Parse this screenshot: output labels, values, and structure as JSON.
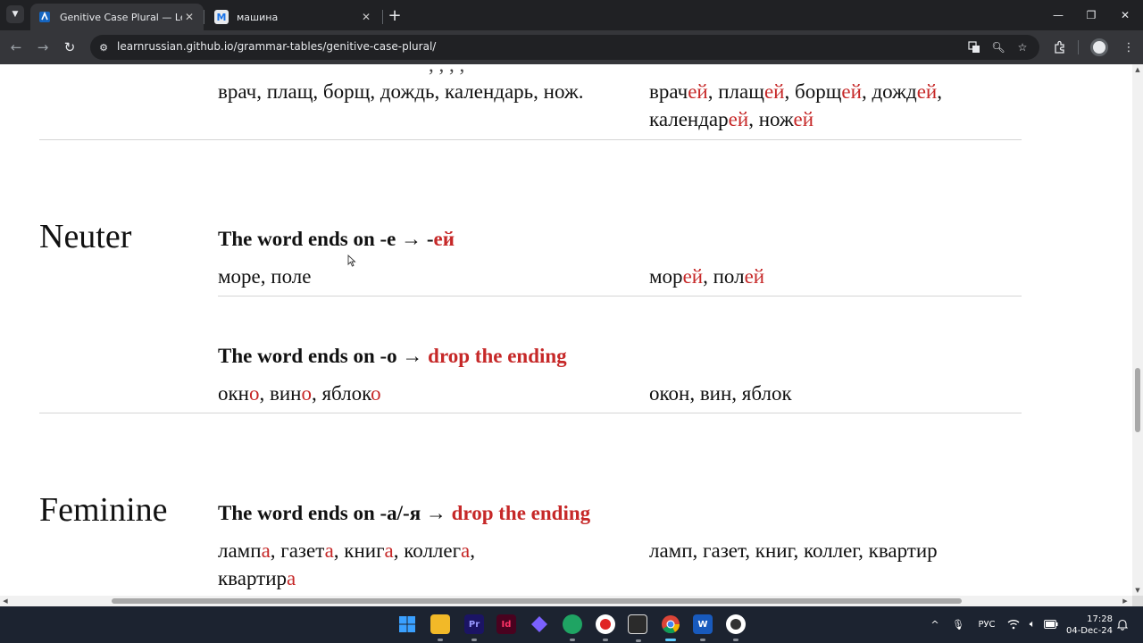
{
  "browser": {
    "tabs": [
      {
        "title": "Genitive Case Plural — LearnRu",
        "favicon": "learnrussian-favicon",
        "active": true
      },
      {
        "title": "машина",
        "favicon": "M",
        "active": false
      }
    ],
    "url": "learnrussian.github.io/grammar-tables/genitive-case-plural/"
  },
  "page": {
    "masculine_tail": {
      "cut_text": ", , , ,",
      "left_parts": [
        {
          "t": "врач, плащ, борщ, дождь, календарь, нож.",
          "r": false
        }
      ],
      "right_parts": [
        {
          "t": "врач",
          "r": false
        },
        {
          "t": "ей",
          "r": true
        },
        {
          "t": ", плащ",
          "r": false
        },
        {
          "t": "ей",
          "r": true
        },
        {
          "t": ", борщ",
          "r": false
        },
        {
          "t": "ей",
          "r": true
        },
        {
          "t": ", дожд",
          "r": false
        },
        {
          "t": "ей",
          "r": true
        },
        {
          "t": ", календар",
          "r": false
        },
        {
          "t": "ей",
          "r": true
        },
        {
          "t": ", нож",
          "r": false
        },
        {
          "t": "ей",
          "r": true
        }
      ]
    },
    "neuter": {
      "label": "Neuter",
      "rules": [
        {
          "rule_parts": [
            {
              "t": "The word ends on -е → -",
              "r": false
            },
            {
              "t": "ей",
              "r": true
            }
          ],
          "left_parts": [
            {
              "t": "море, поле",
              "r": false
            }
          ],
          "right_parts": [
            {
              "t": "мор",
              "r": false
            },
            {
              "t": "ей",
              "r": true
            },
            {
              "t": ", пол",
              "r": false
            },
            {
              "t": "ей",
              "r": true
            }
          ]
        },
        {
          "rule_parts": [
            {
              "t": "The word ends on -о → ",
              "r": false
            },
            {
              "t": "drop the ending",
              "r": true
            }
          ],
          "left_parts": [
            {
              "t": "окн",
              "r": false
            },
            {
              "t": "о",
              "r": true
            },
            {
              "t": ", вин",
              "r": false
            },
            {
              "t": "о",
              "r": true
            },
            {
              "t": ", яблок",
              "r": false
            },
            {
              "t": "о",
              "r": true
            }
          ],
          "right_parts": [
            {
              "t": "окон, вин, яблок",
              "r": false
            }
          ]
        }
      ]
    },
    "feminine": {
      "label": "Feminine",
      "rules": [
        {
          "rule_parts": [
            {
              "t": "The word ends on -а/-я → ",
              "r": false
            },
            {
              "t": "drop the ending",
              "r": true
            }
          ],
          "left_parts": [
            {
              "t": "ламп",
              "r": false
            },
            {
              "t": "а",
              "r": true
            },
            {
              "t": ", газет",
              "r": false
            },
            {
              "t": "а",
              "r": true
            },
            {
              "t": ", книг",
              "r": false
            },
            {
              "t": "а",
              "r": true
            },
            {
              "t": ", коллег",
              "r": false
            },
            {
              "t": "а",
              "r": true
            },
            {
              "t": ", квартир",
              "r": false
            },
            {
              "t": "а",
              "r": true
            }
          ],
          "right_parts": [
            {
              "t": "ламп, газет, книг, коллег, квартир",
              "r": false
            }
          ]
        }
      ]
    }
  },
  "taskbar": {
    "language": "РУС",
    "time": "17:28",
    "date": "04-Dec-24"
  },
  "colors": {
    "accent_red": "#c62828",
    "chrome_dark": "#202124",
    "chrome_toolbar": "#35363a"
  }
}
